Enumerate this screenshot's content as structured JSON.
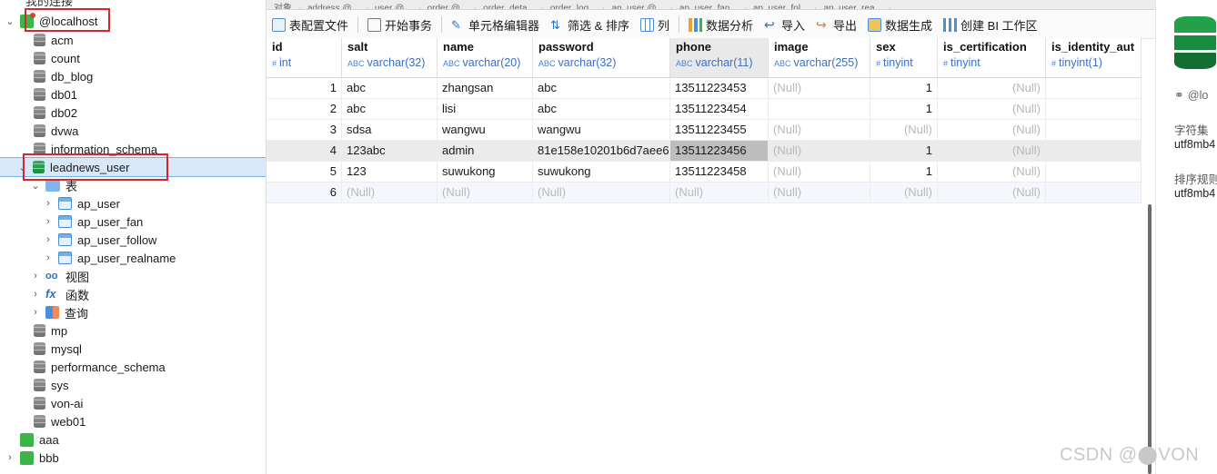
{
  "navigator": {
    "header_label": "我的连接",
    "connection": "@localhost",
    "selected_db": "leadnews_user",
    "databases": [
      "acm",
      "count",
      "db_blog",
      "db01",
      "db02",
      "dvwa",
      "information_schema"
    ],
    "folders": {
      "tables": "表",
      "views": "视图",
      "functions": "函数",
      "queries": "查询"
    },
    "tables": [
      "ap_user",
      "ap_user_fan",
      "ap_user_follow",
      "ap_user_realname"
    ],
    "databases_after": [
      "mp",
      "mysql",
      "performance_schema",
      "sys",
      "von-ai",
      "web01"
    ],
    "other_connections": [
      "aaa",
      "bbb"
    ]
  },
  "tabs": [
    "对象",
    "address @...",
    "user @...",
    "order @...",
    "order_deta...",
    "order_log...",
    "ap_user @...",
    "ap_user_fan...",
    "ap_user_fol...",
    "ap_user_rea..."
  ],
  "toolbar": {
    "table_config": "表配置文件",
    "begin_transaction": "开始事务",
    "cell_editor": "单元格编辑器",
    "filter_sort": "筛选 & 排序",
    "columns": "列",
    "data_analysis": "数据分析",
    "import": "导入",
    "export": "导出",
    "data_generate": "数据生成",
    "create_bi": "创建 BI 工作区"
  },
  "grid": {
    "columns": [
      {
        "name": "id",
        "type": "int",
        "kind": "#"
      },
      {
        "name": "salt",
        "type": "varchar(32)",
        "kind": "ABC"
      },
      {
        "name": "name",
        "type": "varchar(20)",
        "kind": "ABC"
      },
      {
        "name": "password",
        "type": "varchar(32)",
        "kind": "ABC"
      },
      {
        "name": "phone",
        "type": "varchar(11)",
        "kind": "ABC"
      },
      {
        "name": "image",
        "type": "varchar(255)",
        "kind": "ABC"
      },
      {
        "name": "sex",
        "type": "tinyint",
        "kind": "#"
      },
      {
        "name": "is_certification",
        "type": "tinyint",
        "kind": "#"
      },
      {
        "name": "is_identity_aut",
        "type": "tinyint(1)",
        "kind": "#"
      }
    ],
    "rows": [
      [
        "1",
        "abc",
        "zhangsan",
        "abc",
        "13511223453",
        "(Null)",
        "1",
        "(Null)",
        ""
      ],
      [
        "2",
        "abc",
        "lisi",
        "abc",
        "13511223454",
        "",
        "1",
        "(Null)",
        ""
      ],
      [
        "3",
        "sdsa",
        "wangwu",
        "wangwu",
        "13511223455",
        "(Null)",
        "(Null)",
        "(Null)",
        ""
      ],
      [
        "4",
        "123abc",
        "admin",
        "81e158e10201b6d7aee6",
        "13511223456",
        "(Null)",
        "1",
        "(Null)",
        ""
      ],
      [
        "5",
        "123",
        "suwukong",
        "suwukong",
        "13511223458",
        "(Null)",
        "1",
        "(Null)",
        ""
      ],
      [
        "6",
        "(Null)",
        "(Null)",
        "(Null)",
        "(Null)",
        "(Null)",
        "(Null)",
        "(Null)",
        ""
      ]
    ],
    "selected_row": 3,
    "selected_column": "phone"
  },
  "right_panel": {
    "name": "@lo",
    "charset_label": "字符集",
    "charset_value": "utf8mb4",
    "collation_label": "排序规则",
    "collation_value": "utf8mb4"
  },
  "watermark": "CSDN @⬤VON",
  "colors": {
    "accent": "#2a6fc9",
    "selection": "#d7e8fa",
    "highlight": "#bdbdbd",
    "annotation_red": "#d9252c"
  }
}
